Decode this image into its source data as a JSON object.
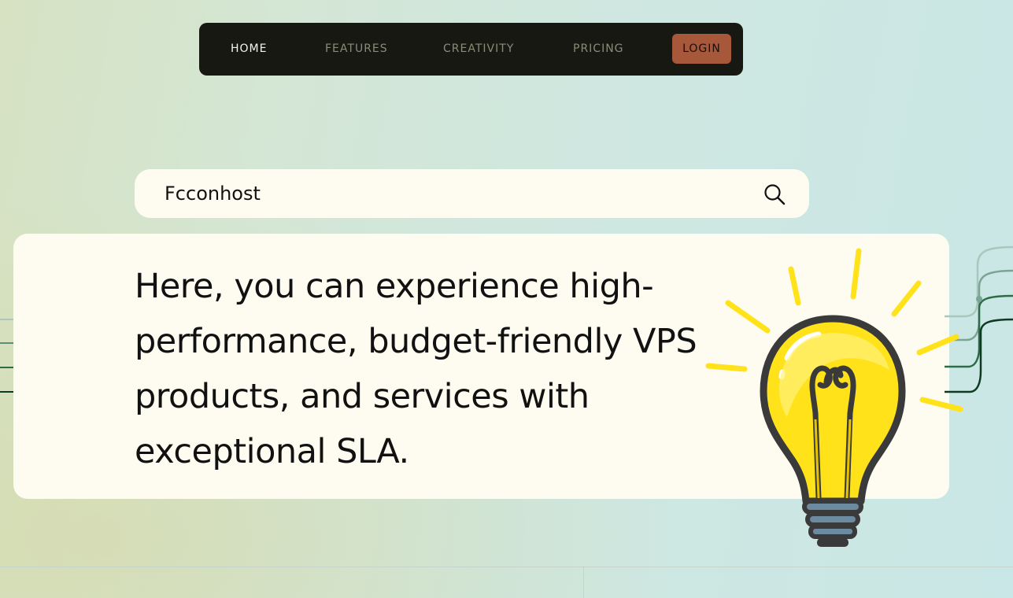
{
  "nav": {
    "items": [
      {
        "label": "HOME",
        "active": true
      },
      {
        "label": "FEATURES",
        "active": false
      },
      {
        "label": "CREATIVITY",
        "active": false
      },
      {
        "label": "PRICING",
        "active": false
      }
    ],
    "login_label": "LOGIN"
  },
  "search": {
    "value": "Fcconhost",
    "icon": "search-icon"
  },
  "hero": {
    "text": "Here, you can experience high-performance, budget-friendly VPS products, and services with exceptional SLA.",
    "illustration": "lightbulb-icon"
  },
  "colors": {
    "nav_bg": "#181812",
    "login_bg": "#a7573a",
    "card_bg": "#fefcf0",
    "bulb_yellow": "#ffe21a"
  }
}
